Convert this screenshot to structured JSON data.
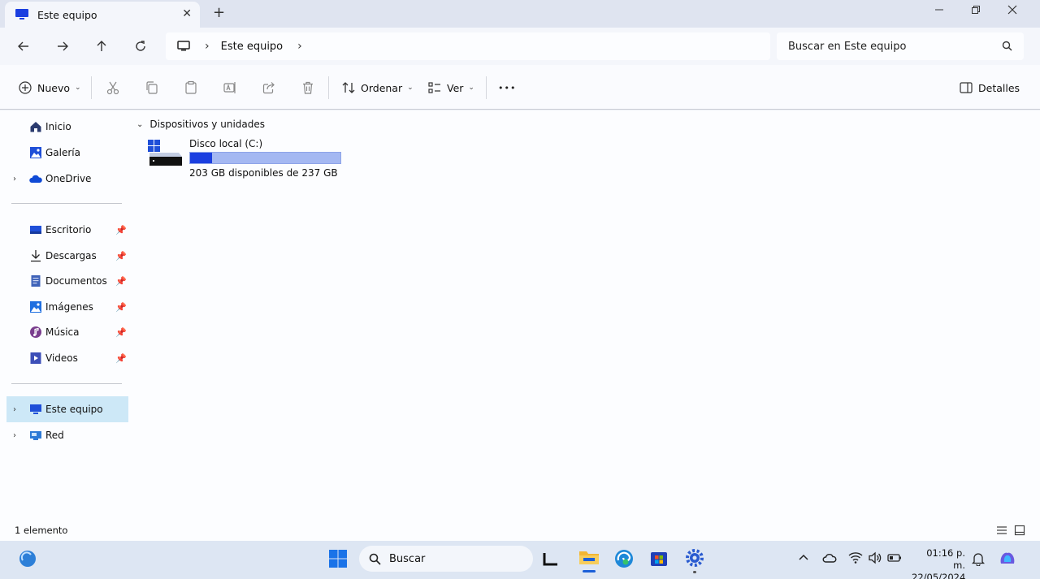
{
  "window": {
    "tab_title": "Este equipo",
    "new_tab_symbol": "+",
    "close_symbol": "✕"
  },
  "nav": {
    "breadcrumb": [
      "Este equipo"
    ],
    "search_placeholder": "Buscar en Este equipo"
  },
  "commands": {
    "new_label": "Nuevo",
    "sort_label": "Ordenar",
    "view_label": "Ver",
    "details_label": "Detalles",
    "more_symbol": "•••"
  },
  "sidebar": {
    "top_items": [
      {
        "label": "Inicio",
        "icon": "home-icon"
      },
      {
        "label": "Galería",
        "icon": "gallery-icon"
      },
      {
        "label": "OneDrive",
        "icon": "onedrive-icon"
      }
    ],
    "pinned_items": [
      {
        "label": "Escritorio",
        "icon": "desktop-icon"
      },
      {
        "label": "Descargas",
        "icon": "download-icon"
      },
      {
        "label": "Documentos",
        "icon": "documents-icon"
      },
      {
        "label": "Imágenes",
        "icon": "pictures-icon"
      },
      {
        "label": "Música",
        "icon": "music-icon"
      },
      {
        "label": "Videos",
        "icon": "videos-icon"
      }
    ],
    "bottom_items": [
      {
        "label": "Este equipo",
        "icon": "this-pc-icon",
        "selected": true
      },
      {
        "label": "Red",
        "icon": "network-icon"
      }
    ]
  },
  "content": {
    "group_title": "Dispositivos y unidades",
    "drives": [
      {
        "name": "Disco local (C:)",
        "free_text": "203 GB disponibles de 237 GB",
        "used_fraction": 0.1435
      }
    ]
  },
  "status": {
    "item_count": "1 elemento"
  },
  "taskbar": {
    "search_label": "Buscar",
    "time": "01:16 p. m.",
    "date": "22/05/2024"
  },
  "colors": {
    "accent": "#1b3fe0",
    "drive_bar_bg": "#a4b8f2",
    "selected_bg": "#cde8f7"
  }
}
